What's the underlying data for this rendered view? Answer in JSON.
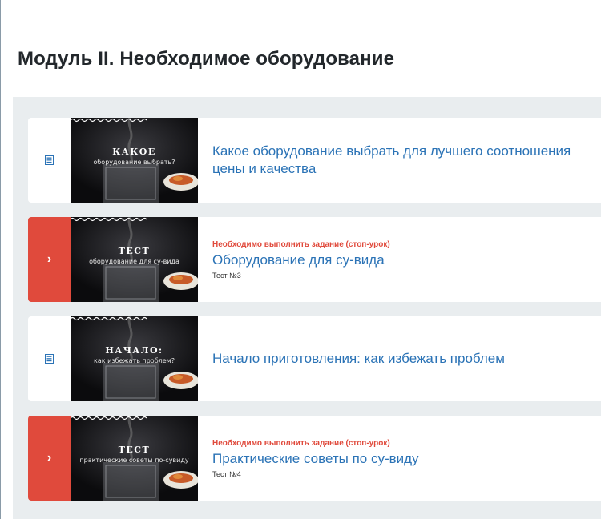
{
  "module": {
    "title": "Модуль II. Необходимое оборудование"
  },
  "colors": {
    "accent_red": "#e04a3c",
    "link_blue": "#2b73b6",
    "panel_bg": "#e9edef"
  },
  "lessons": [
    {
      "icon": "document-icon",
      "thumb_headline": "КАКОЕ",
      "thumb_sub": "оборудование выбрать?",
      "warning": "",
      "title": "Какое оборудование выбрать для лучшего соотношения цены и качества",
      "subtitle": ""
    },
    {
      "icon": "chevron-right-icon",
      "thumb_headline": "ТЕСТ",
      "thumb_sub": "оборудование для су-вида",
      "warning": "Необходимо выполнить задание (стоп-урок)",
      "title": "Оборудование для су-вида",
      "subtitle": "Тест №3"
    },
    {
      "icon": "document-icon",
      "thumb_headline": "НАЧАЛО:",
      "thumb_sub": "как избежать проблем?",
      "warning": "",
      "title": "Начало приготовления: как избежать проблем",
      "subtitle": ""
    },
    {
      "icon": "chevron-right-icon",
      "thumb_headline": "ТЕСТ",
      "thumb_sub": "практические советы по-сувиду",
      "warning": "Необходимо выполнить задание (стоп-урок)",
      "title": "Практические советы по су-виду",
      "subtitle": "Тест №4"
    }
  ]
}
